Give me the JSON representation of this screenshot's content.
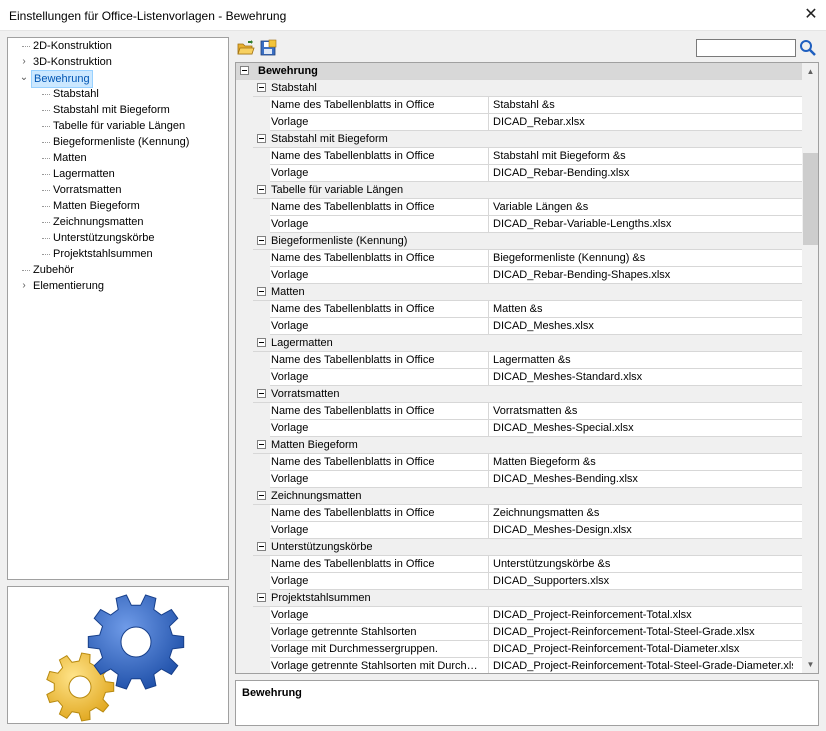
{
  "window": {
    "title": "Einstellungen für Office-Listenvorlagen - Bewehrung",
    "close": "✕"
  },
  "tree": [
    {
      "label": "2D-Konstruktion",
      "level": 0,
      "expander": ""
    },
    {
      "label": "3D-Konstruktion",
      "level": 0,
      "expander": "›"
    },
    {
      "label": "Bewehrung",
      "level": 0,
      "expander": "⌄",
      "selected": true
    },
    {
      "label": "Stabstahl",
      "level": 1,
      "expander": ""
    },
    {
      "label": "Stabstahl mit Biegeform",
      "level": 1,
      "expander": ""
    },
    {
      "label": "Tabelle für variable Längen",
      "level": 1,
      "expander": ""
    },
    {
      "label": "Biegeformenliste (Kennung)",
      "level": 1,
      "expander": ""
    },
    {
      "label": "Matten",
      "level": 1,
      "expander": ""
    },
    {
      "label": "Lagermatten",
      "level": 1,
      "expander": ""
    },
    {
      "label": "Vorratsmatten",
      "level": 1,
      "expander": ""
    },
    {
      "label": "Matten Biegeform",
      "level": 1,
      "expander": ""
    },
    {
      "label": "Zeichnungsmatten",
      "level": 1,
      "expander": ""
    },
    {
      "label": "Unterstützungskörbe",
      "level": 1,
      "expander": ""
    },
    {
      "label": "Projektstahlsummen",
      "level": 1,
      "expander": ""
    },
    {
      "label": "Zubehör",
      "level": 0,
      "expander": ""
    },
    {
      "label": "Elementierung",
      "level": 0,
      "expander": "›"
    }
  ],
  "toolbar": {
    "open_icon": "folder-open-icon",
    "save_icon": "save-icon",
    "search_value": "",
    "search_icon": "magnifier-icon"
  },
  "grid": {
    "top_group": "Bewehrung",
    "groups": [
      {
        "title": "Stabstahl",
        "rows": [
          {
            "name": "Name des Tabellenblatts in Office",
            "value": "Stabstahl &s"
          },
          {
            "name": "Vorlage",
            "value": "DICAD_Rebar.xlsx"
          }
        ]
      },
      {
        "title": "Stabstahl mit Biegeform",
        "rows": [
          {
            "name": "Name des Tabellenblatts in Office",
            "value": "Stabstahl mit Biegeform &s"
          },
          {
            "name": "Vorlage",
            "value": "DICAD_Rebar-Bending.xlsx"
          }
        ]
      },
      {
        "title": "Tabelle für variable Längen",
        "rows": [
          {
            "name": "Name des Tabellenblatts in Office",
            "value": "Variable Längen &s"
          },
          {
            "name": "Vorlage",
            "value": "DICAD_Rebar-Variable-Lengths.xlsx"
          }
        ]
      },
      {
        "title": "Biegeformenliste (Kennung)",
        "rows": [
          {
            "name": "Name des Tabellenblatts in Office",
            "value": "Biegeformenliste (Kennung) &s"
          },
          {
            "name": "Vorlage",
            "value": "DICAD_Rebar-Bending-Shapes.xlsx"
          }
        ]
      },
      {
        "title": "Matten",
        "rows": [
          {
            "name": "Name des Tabellenblatts in Office",
            "value": "Matten &s"
          },
          {
            "name": "Vorlage",
            "value": "DICAD_Meshes.xlsx"
          }
        ]
      },
      {
        "title": "Lagermatten",
        "rows": [
          {
            "name": "Name des Tabellenblatts in Office",
            "value": "Lagermatten &s"
          },
          {
            "name": "Vorlage",
            "value": "DICAD_Meshes-Standard.xlsx"
          }
        ]
      },
      {
        "title": "Vorratsmatten",
        "rows": [
          {
            "name": "Name des Tabellenblatts in Office",
            "value": "Vorratsmatten &s"
          },
          {
            "name": "Vorlage",
            "value": "DICAD_Meshes-Special.xlsx"
          }
        ]
      },
      {
        "title": "Matten Biegeform",
        "rows": [
          {
            "name": "Name des Tabellenblatts in Office",
            "value": "Matten Biegeform &s"
          },
          {
            "name": "Vorlage",
            "value": "DICAD_Meshes-Bending.xlsx"
          }
        ]
      },
      {
        "title": "Zeichnungsmatten",
        "rows": [
          {
            "name": "Name des Tabellenblatts in Office",
            "value": "Zeichnungsmatten &s"
          },
          {
            "name": "Vorlage",
            "value": "DICAD_Meshes-Design.xlsx"
          }
        ]
      },
      {
        "title": "Unterstützungskörbe",
        "rows": [
          {
            "name": "Name des Tabellenblatts in Office",
            "value": "Unterstützungskörbe &s"
          },
          {
            "name": "Vorlage",
            "value": "DICAD_Supporters.xlsx"
          }
        ]
      },
      {
        "title": "Projektstahlsummen",
        "rows": [
          {
            "name": "Vorlage",
            "value": "DICAD_Project-Reinforcement-Total.xlsx"
          },
          {
            "name": "Vorlage getrennte Stahlsorten",
            "value": "DICAD_Project-Reinforcement-Total-Steel-Grade.xlsx"
          },
          {
            "name": "Vorlage mit Durchmessergruppen.",
            "value": "DICAD_Project-Reinforcement-Total-Diameter.xlsx"
          },
          {
            "name": "Vorlage getrennte Stahlsorten mit Durchmesse",
            "value": "DICAD_Project-Reinforcement-Total-Steel-Grade-Diameter.xlsx"
          }
        ]
      }
    ]
  },
  "scrollbar": {
    "up": "▲",
    "down": "▼"
  },
  "description": {
    "title": "Bewehrung"
  },
  "colors": {
    "accent": "#0055b3",
    "selection": "#cce8ff",
    "gear_blue": "#2f67c8",
    "gear_yellow": "#f2c43a"
  }
}
